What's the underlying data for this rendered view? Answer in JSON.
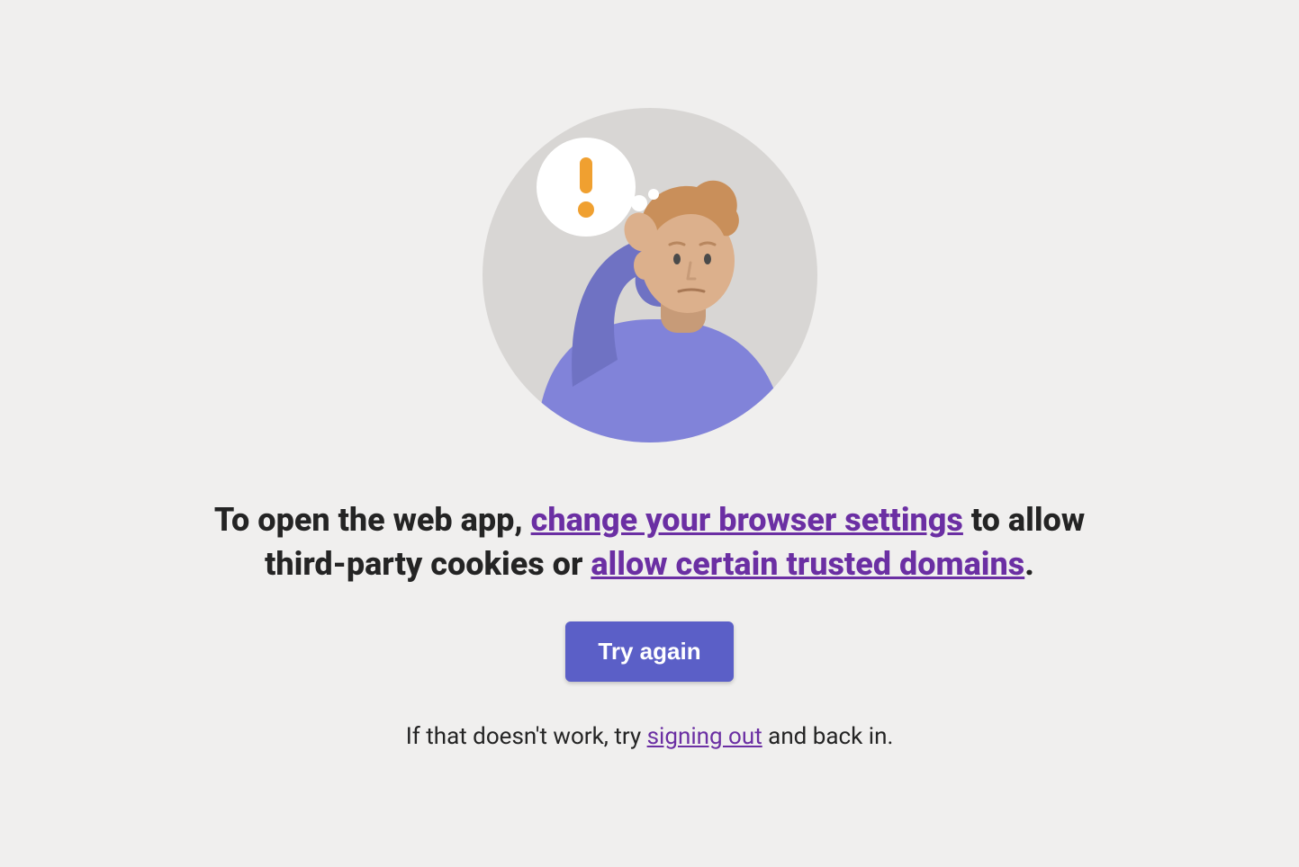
{
  "heading": {
    "part1": "To open the web app, ",
    "link1": "change your browser settings",
    "part2": " to allow third-party cookies or ",
    "link2": "allow certain trusted domains",
    "part3": "."
  },
  "button": {
    "try_again": "Try again"
  },
  "subtext": {
    "part1": "If that doesn't work, try ",
    "link": "signing out",
    "part2": " and back in."
  }
}
